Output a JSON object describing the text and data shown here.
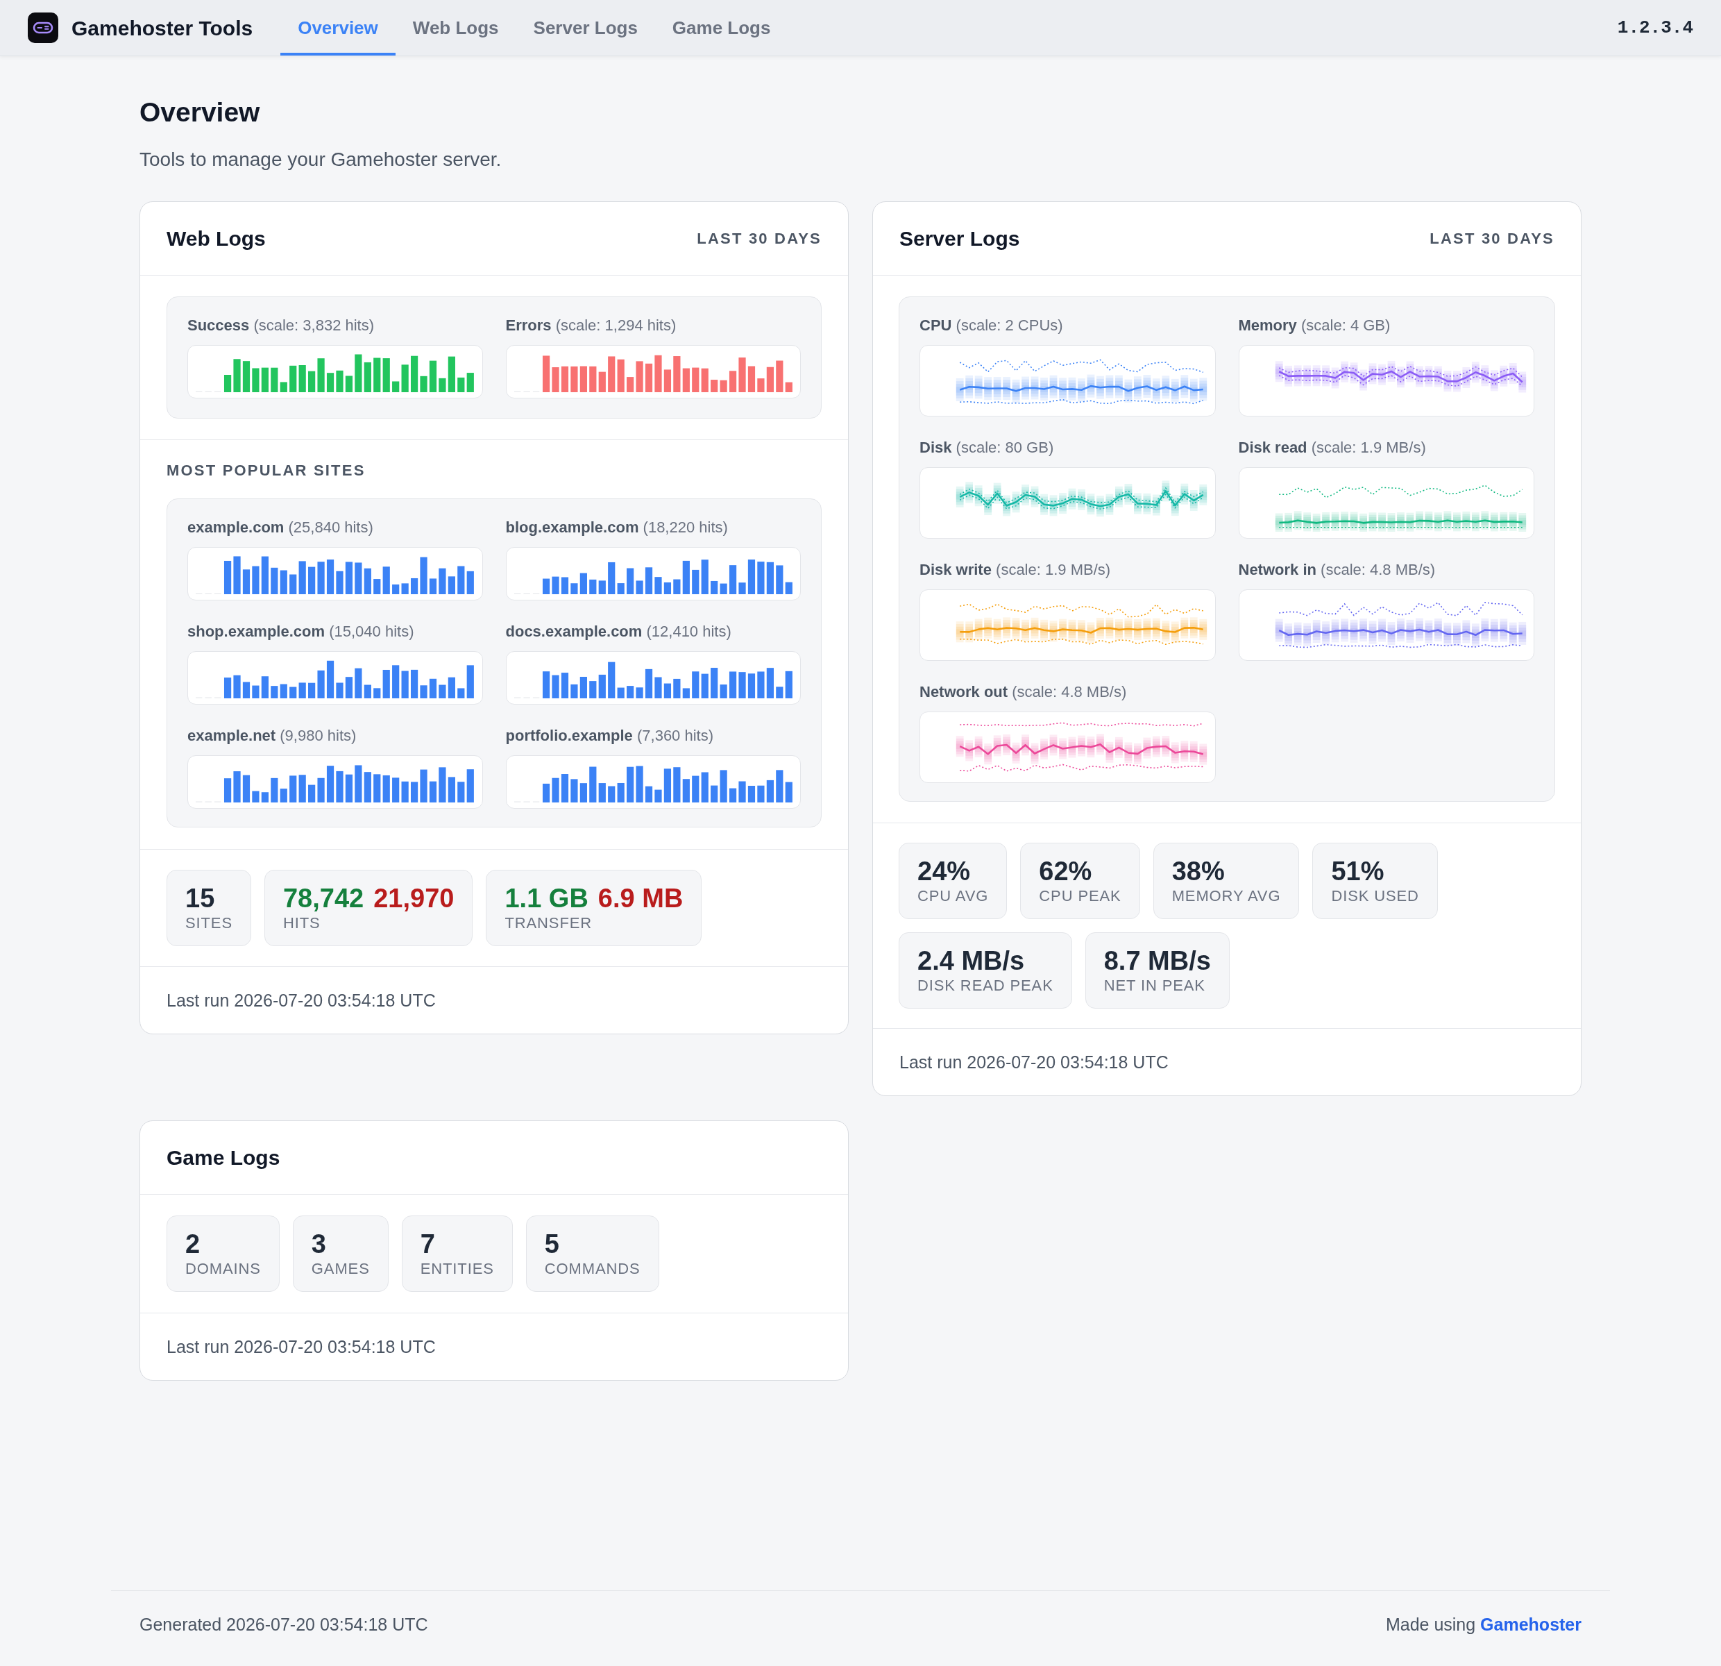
{
  "app": {
    "title": "Gamehoster Tools",
    "version": "1.2.3.4"
  },
  "tabs": [
    {
      "label": "Overview",
      "selected": true
    },
    {
      "label": "Web Logs",
      "selected": false
    },
    {
      "label": "Server Logs",
      "selected": false
    },
    {
      "label": "Game Logs",
      "selected": false
    }
  ],
  "page": {
    "title": "Overview",
    "subtitle": "Tools to manage your Gamehoster server."
  },
  "web_logs": {
    "title": "Web Logs",
    "period": "LAST 30 DAYS",
    "charts": [
      {
        "label": "**Success** (scale: 3,832 hits)",
        "color": "#22c55e"
      },
      {
        "label": "**Errors** (scale: 1,294 hits)",
        "color": "#f87171"
      }
    ],
    "sites_heading": "MOST POPULAR SITES",
    "sites": [
      {
        "label": "**example.com** (25,840 hits)"
      },
      {
        "label": "**blog.example.com** (18,220 hits)"
      },
      {
        "label": "**shop.example.com** (15,040 hits)"
      },
      {
        "label": "**docs.example.com** (12,410 hits)"
      },
      {
        "label": "**example.net** (9,980 hits)"
      },
      {
        "label": "**portfolio.example** (7,360 hits)"
      }
    ],
    "stats": [
      {
        "values": [
          {
            "text": "15"
          }
        ],
        "label": "SITES"
      },
      {
        "values": [
          {
            "text": "78,742",
            "color": "#15803d"
          },
          {
            "text": "21,970",
            "color": "#b91c1c"
          }
        ],
        "label": "HITS"
      },
      {
        "values": [
          {
            "text": "1.1 GB",
            "color": "#15803d"
          },
          {
            "text": "6.9 MB",
            "color": "#b91c1c"
          }
        ],
        "label": "TRANSFER"
      }
    ],
    "last_run": "Last run 2026-07-20 03:54:18 UTC"
  },
  "server_logs": {
    "title": "Server Logs",
    "period": "LAST 30 DAYS",
    "metrics": [
      {
        "label": "**CPU** (scale: 2 CPUs)",
        "color": "#3b82f6"
      },
      {
        "label": "**Memory** (scale: 4 GB)",
        "color": "#8b5cf6"
      },
      {
        "label": "**Disk** (scale: 80 GB)",
        "color": "#14b8a6"
      },
      {
        "label": "**Disk read** (scale: 1.9 MB/s)",
        "color": "#10b981"
      },
      {
        "label": "**Disk write** (scale: 1.9 MB/s)",
        "color": "#f59e0b"
      },
      {
        "label": "**Network in** (scale: 4.8 MB/s)",
        "color": "#6366f1"
      },
      {
        "label": "**Network out** (scale: 4.8 MB/s)",
        "color": "#ec4899"
      }
    ],
    "stats": [
      {
        "values": [
          {
            "text": "24%"
          }
        ],
        "label": "CPU AVG"
      },
      {
        "values": [
          {
            "text": "62%"
          }
        ],
        "label": "CPU PEAK"
      },
      {
        "values": [
          {
            "text": "38%"
          }
        ],
        "label": "MEMORY AVG"
      },
      {
        "values": [
          {
            "text": "51%"
          }
        ],
        "label": "DISK USED"
      },
      {
        "values": [
          {
            "text": "2.4 MB/s"
          }
        ],
        "label": "DISK READ PEAK"
      },
      {
        "values": [
          {
            "text": "8.7 MB/s"
          }
        ],
        "label": "NET IN PEAK"
      }
    ],
    "last_run": "Last run 2026-07-20 03:54:18 UTC"
  },
  "game_logs": {
    "title": "Game Logs",
    "stats": [
      {
        "values": [
          {
            "text": "2"
          }
        ],
        "label": "DOMAINS"
      },
      {
        "values": [
          {
            "text": "3"
          }
        ],
        "label": "GAMES"
      },
      {
        "values": [
          {
            "text": "7"
          }
        ],
        "label": "ENTITIES"
      },
      {
        "values": [
          {
            "text": "5"
          }
        ],
        "label": "COMMANDS"
      }
    ],
    "last_run": "Last run 2026-07-20 03:54:18 UTC"
  },
  "footer": {
    "generated": "Generated 2026-07-20 03:54:18 UTC",
    "credit": "Made using",
    "link": "Gamehoster"
  }
}
